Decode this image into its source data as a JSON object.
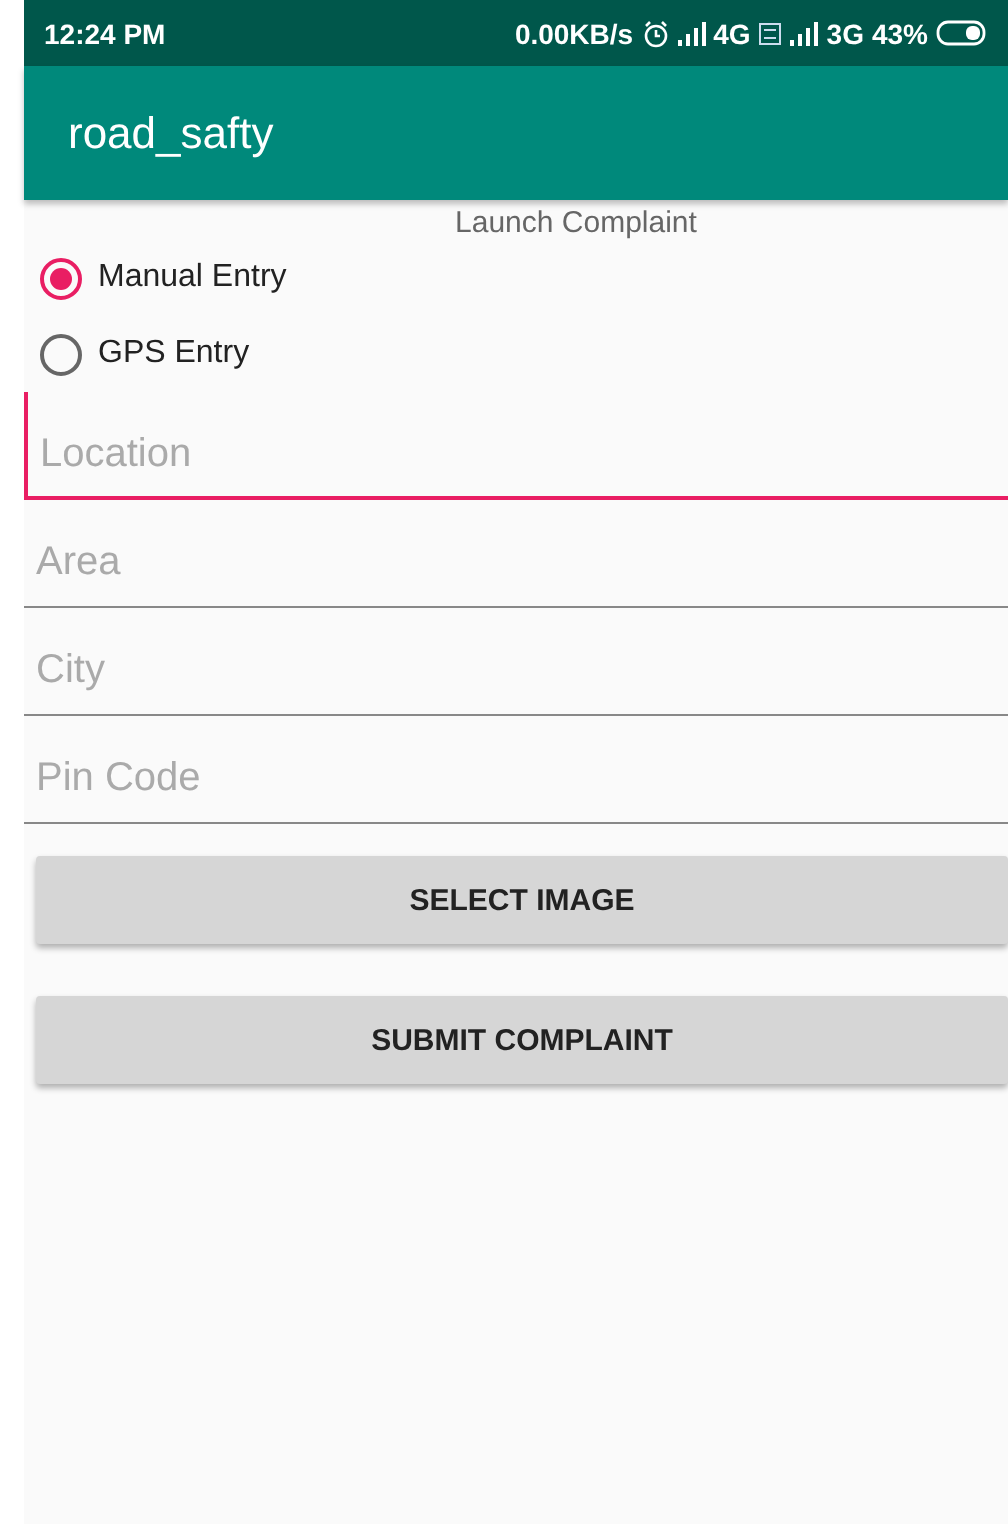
{
  "status_bar": {
    "time": "12:24 PM",
    "speed": "0.00KB/s",
    "network_1": "4G",
    "network_2": "3G",
    "battery": "43%"
  },
  "app_bar": {
    "title": "road_safty"
  },
  "heading": "Launch Complaint",
  "entry_modes": [
    {
      "label": "Manual Entry",
      "selected": true
    },
    {
      "label": "GPS Entry",
      "selected": false
    }
  ],
  "fields": [
    {
      "placeholder": "Location",
      "focused": true
    },
    {
      "placeholder": "Area",
      "focused": false
    },
    {
      "placeholder": "City",
      "focused": false
    },
    {
      "placeholder": "Pin Code",
      "focused": false
    }
  ],
  "buttons": [
    "SELECT IMAGE",
    "SUBMIT COMPLAINT"
  ]
}
